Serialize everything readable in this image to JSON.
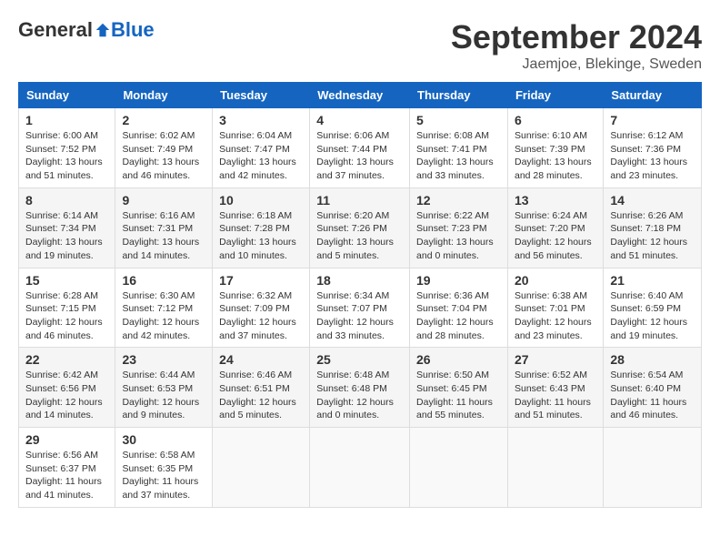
{
  "header": {
    "logo_general": "General",
    "logo_blue": "Blue",
    "month_title": "September 2024",
    "location": "Jaemjoe, Blekinge, Sweden"
  },
  "columns": [
    "Sunday",
    "Monday",
    "Tuesday",
    "Wednesday",
    "Thursday",
    "Friday",
    "Saturday"
  ],
  "weeks": [
    [
      {
        "day": "1",
        "sunrise": "6:00 AM",
        "sunset": "7:52 PM",
        "daylight": "13 hours and 51 minutes."
      },
      {
        "day": "2",
        "sunrise": "6:02 AM",
        "sunset": "7:49 PM",
        "daylight": "13 hours and 46 minutes."
      },
      {
        "day": "3",
        "sunrise": "6:04 AM",
        "sunset": "7:47 PM",
        "daylight": "13 hours and 42 minutes."
      },
      {
        "day": "4",
        "sunrise": "6:06 AM",
        "sunset": "7:44 PM",
        "daylight": "13 hours and 37 minutes."
      },
      {
        "day": "5",
        "sunrise": "6:08 AM",
        "sunset": "7:41 PM",
        "daylight": "13 hours and 33 minutes."
      },
      {
        "day": "6",
        "sunrise": "6:10 AM",
        "sunset": "7:39 PM",
        "daylight": "13 hours and 28 minutes."
      },
      {
        "day": "7",
        "sunrise": "6:12 AM",
        "sunset": "7:36 PM",
        "daylight": "13 hours and 23 minutes."
      }
    ],
    [
      {
        "day": "8",
        "sunrise": "6:14 AM",
        "sunset": "7:34 PM",
        "daylight": "13 hours and 19 minutes."
      },
      {
        "day": "9",
        "sunrise": "6:16 AM",
        "sunset": "7:31 PM",
        "daylight": "13 hours and 14 minutes."
      },
      {
        "day": "10",
        "sunrise": "6:18 AM",
        "sunset": "7:28 PM",
        "daylight": "13 hours and 10 minutes."
      },
      {
        "day": "11",
        "sunrise": "6:20 AM",
        "sunset": "7:26 PM",
        "daylight": "13 hours and 5 minutes."
      },
      {
        "day": "12",
        "sunrise": "6:22 AM",
        "sunset": "7:23 PM",
        "daylight": "13 hours and 0 minutes."
      },
      {
        "day": "13",
        "sunrise": "6:24 AM",
        "sunset": "7:20 PM",
        "daylight": "12 hours and 56 minutes."
      },
      {
        "day": "14",
        "sunrise": "6:26 AM",
        "sunset": "7:18 PM",
        "daylight": "12 hours and 51 minutes."
      }
    ],
    [
      {
        "day": "15",
        "sunrise": "6:28 AM",
        "sunset": "7:15 PM",
        "daylight": "12 hours and 46 minutes."
      },
      {
        "day": "16",
        "sunrise": "6:30 AM",
        "sunset": "7:12 PM",
        "daylight": "12 hours and 42 minutes."
      },
      {
        "day": "17",
        "sunrise": "6:32 AM",
        "sunset": "7:09 PM",
        "daylight": "12 hours and 37 minutes."
      },
      {
        "day": "18",
        "sunrise": "6:34 AM",
        "sunset": "7:07 PM",
        "daylight": "12 hours and 33 minutes."
      },
      {
        "day": "19",
        "sunrise": "6:36 AM",
        "sunset": "7:04 PM",
        "daylight": "12 hours and 28 minutes."
      },
      {
        "day": "20",
        "sunrise": "6:38 AM",
        "sunset": "7:01 PM",
        "daylight": "12 hours and 23 minutes."
      },
      {
        "day": "21",
        "sunrise": "6:40 AM",
        "sunset": "6:59 PM",
        "daylight": "12 hours and 19 minutes."
      }
    ],
    [
      {
        "day": "22",
        "sunrise": "6:42 AM",
        "sunset": "6:56 PM",
        "daylight": "12 hours and 14 minutes."
      },
      {
        "day": "23",
        "sunrise": "6:44 AM",
        "sunset": "6:53 PM",
        "daylight": "12 hours and 9 minutes."
      },
      {
        "day": "24",
        "sunrise": "6:46 AM",
        "sunset": "6:51 PM",
        "daylight": "12 hours and 5 minutes."
      },
      {
        "day": "25",
        "sunrise": "6:48 AM",
        "sunset": "6:48 PM",
        "daylight": "12 hours and 0 minutes."
      },
      {
        "day": "26",
        "sunrise": "6:50 AM",
        "sunset": "6:45 PM",
        "daylight": "11 hours and 55 minutes."
      },
      {
        "day": "27",
        "sunrise": "6:52 AM",
        "sunset": "6:43 PM",
        "daylight": "11 hours and 51 minutes."
      },
      {
        "day": "28",
        "sunrise": "6:54 AM",
        "sunset": "6:40 PM",
        "daylight": "11 hours and 46 minutes."
      }
    ],
    [
      {
        "day": "29",
        "sunrise": "6:56 AM",
        "sunset": "6:37 PM",
        "daylight": "11 hours and 41 minutes."
      },
      {
        "day": "30",
        "sunrise": "6:58 AM",
        "sunset": "6:35 PM",
        "daylight": "11 hours and 37 minutes."
      },
      null,
      null,
      null,
      null,
      null
    ]
  ],
  "labels": {
    "sunrise_prefix": "Sunrise: ",
    "sunset_prefix": "Sunset: ",
    "daylight_prefix": "Daylight: "
  }
}
